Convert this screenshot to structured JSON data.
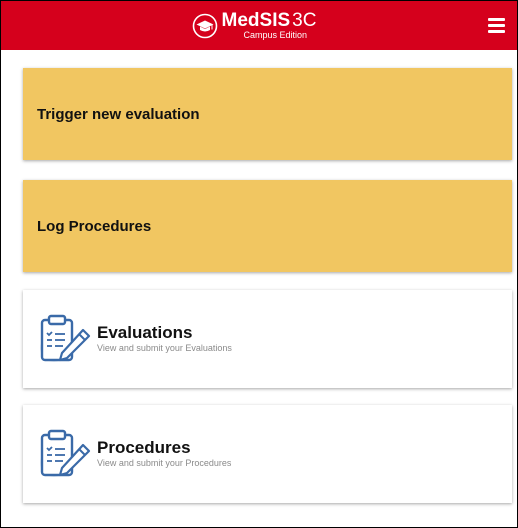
{
  "header": {
    "brand_name": "MedSIS",
    "brand_version": "3C",
    "brand_subtitle": "Campus Edition",
    "logo_icon": "graduation-cap-icon",
    "menu_icon": "hamburger-menu-icon",
    "background_color": "#d5001c"
  },
  "actions": [
    {
      "label": "Trigger new evaluation",
      "color": "#f1c661"
    },
    {
      "label": "Log Procedures",
      "color": "#f1c661"
    }
  ],
  "modules": [
    {
      "title": "Evaluations",
      "description": "View and submit your Evaluations",
      "icon": "clipboard-pencil-icon"
    },
    {
      "title": "Procedures",
      "description": "View and submit your Procedures",
      "icon": "clipboard-pencil-icon"
    }
  ]
}
